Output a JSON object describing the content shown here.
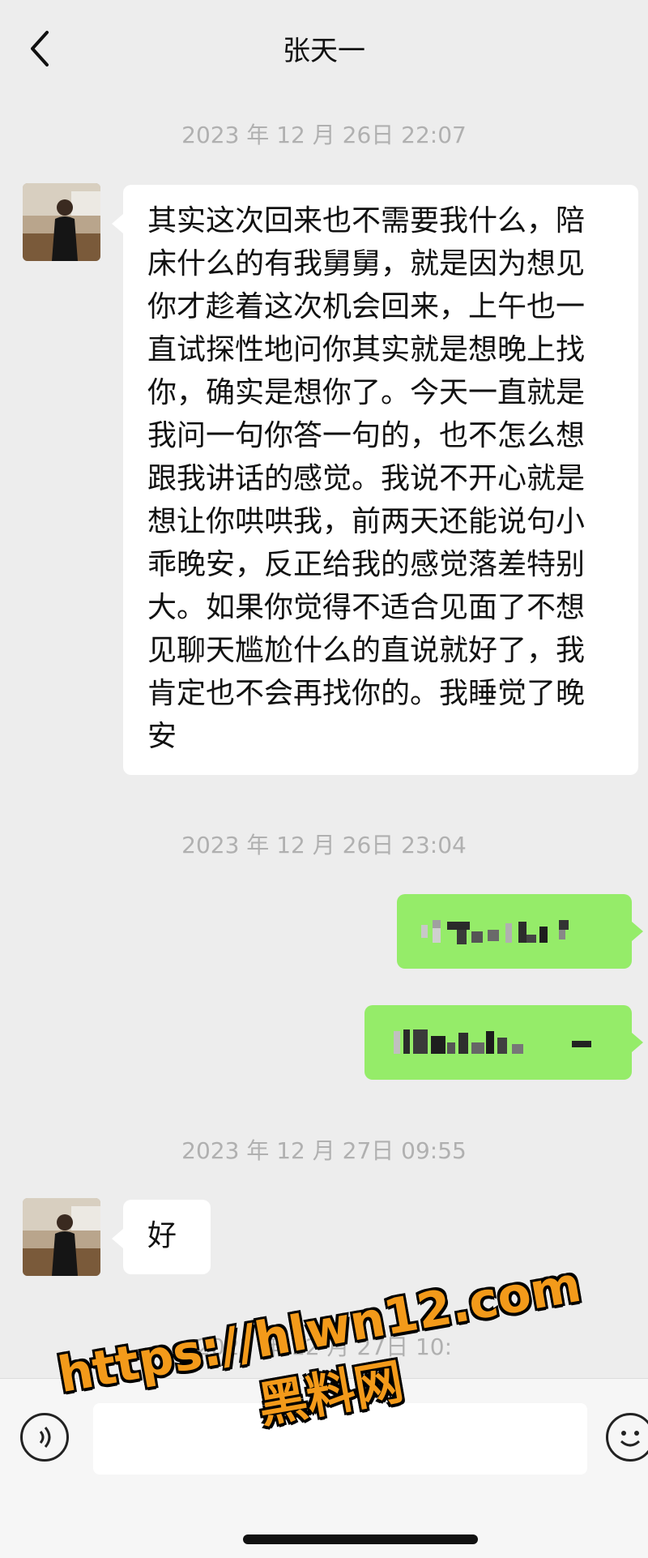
{
  "header": {
    "title": "张天一"
  },
  "messages": [
    {
      "type": "timestamp",
      "text": "2023 年 12 月 26日 22:07"
    },
    {
      "type": "incoming",
      "sender": "张天一",
      "lines": [
        "其实这次回来也不需要我什么，陪",
        "床什么的有我舅舅，就是因为想见",
        "你才趁着这次机会回来，上午也一",
        "直试探性地问你其实就是想晚上找",
        "你，确实是想你了。今天一直就是",
        "我问一句你答一句的，也不怎么想",
        "跟我讲话的感觉。我说不开心就是",
        "想让你哄哄我，前两天还能说句小",
        "乖晚安，反正给我的感觉落差特别",
        "大。如果你觉得不适合见面了不想",
        "见聊天尴尬什么的直说就好了，我",
        "肯定也不会再找你的。我睡觉了晚",
        "安"
      ]
    },
    {
      "type": "timestamp",
      "text": "2023 年 12 月 26日 23:04"
    },
    {
      "type": "outgoing",
      "content": "pixelated"
    },
    {
      "type": "outgoing",
      "content": "pixelated"
    },
    {
      "type": "timestamp",
      "text": "2023 年 12 月 27日 09:55"
    },
    {
      "type": "incoming",
      "sender": "张天一",
      "lines": [
        "好"
      ]
    },
    {
      "type": "timestamp",
      "text": "2023 年 12 月 27日 10:"
    }
  ],
  "watermark": {
    "line1": "https://hlwn12.com",
    "line2": "黑料网",
    "color": "#f39a1a"
  },
  "icons": {
    "back": "chevron-left-icon",
    "voice": "voice-icon",
    "emoji": "emoji-icon"
  },
  "colors": {
    "background": "#ededed",
    "outgoing_bubble": "#95ec69",
    "incoming_bubble": "#ffffff",
    "timestamp": "#b0b0b0"
  }
}
